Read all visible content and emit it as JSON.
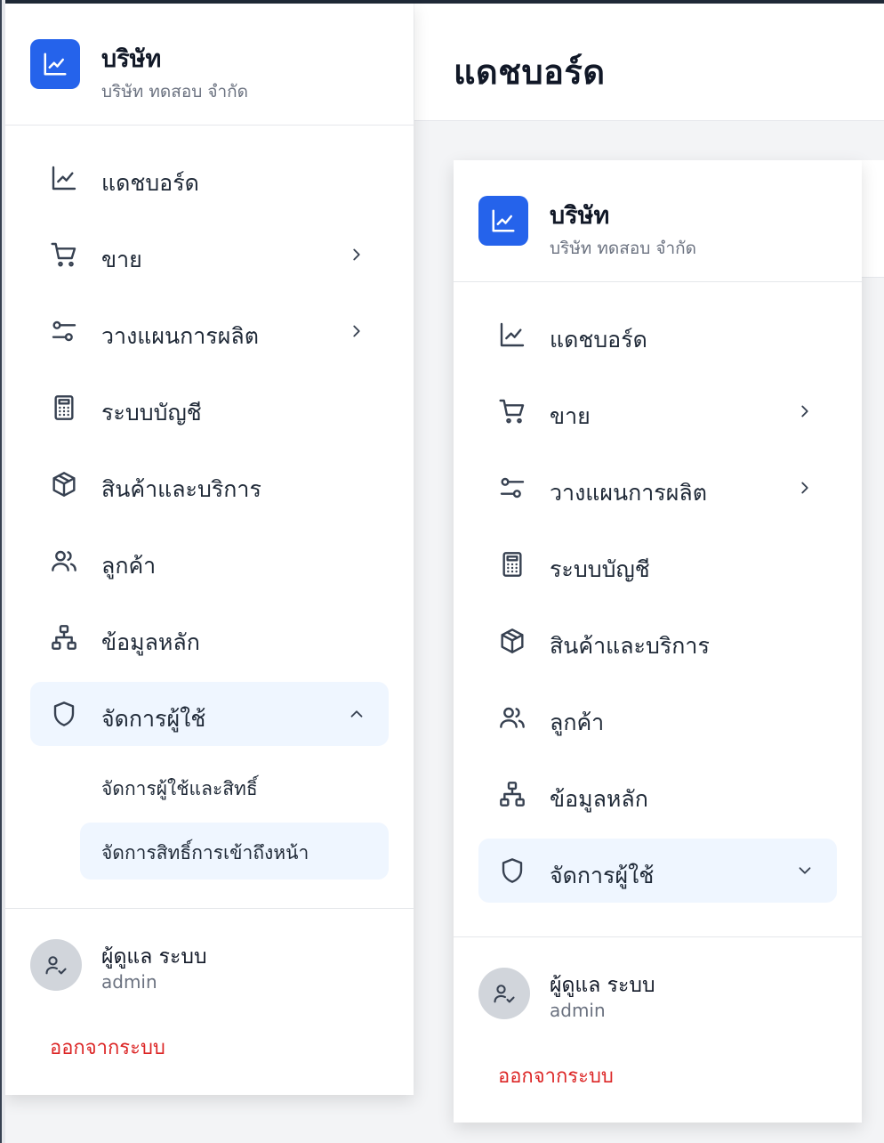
{
  "page": {
    "title": "แดชบอร์ด"
  },
  "brand": {
    "name": "บริษัท",
    "subtitle": "บริษัท ทดสอบ จำกัด"
  },
  "nav": {
    "items": [
      {
        "label": "แดชบอร์ด",
        "icon": "chart-line-icon"
      },
      {
        "label": "ขาย",
        "icon": "cart-icon"
      },
      {
        "label": "วางแผนการผลิต",
        "icon": "sliders-icon"
      },
      {
        "label": "ระบบบัญชี",
        "icon": "calculator-icon"
      },
      {
        "label": "สินค้าและบริการ",
        "icon": "box-icon"
      },
      {
        "label": "ลูกค้า",
        "icon": "users-icon"
      },
      {
        "label": "ข้อมูลหลัก",
        "icon": "network-icon"
      },
      {
        "label": "จัดการผู้ใช้",
        "icon": "shield-icon"
      }
    ],
    "user_management_sub": [
      {
        "label": "จัดการผู้ใช้และสิทธิ์"
      },
      {
        "label": "จัดการสิทธิ์การเข้าถึงหน้า"
      }
    ]
  },
  "user": {
    "name": "ผู้ดูแล ระบบ",
    "role": "admin"
  },
  "logout_label": "ออกจากระบบ",
  "colors": {
    "accent": "#2563eb",
    "active_bg": "#eff6ff",
    "logout": "#dc2626"
  }
}
